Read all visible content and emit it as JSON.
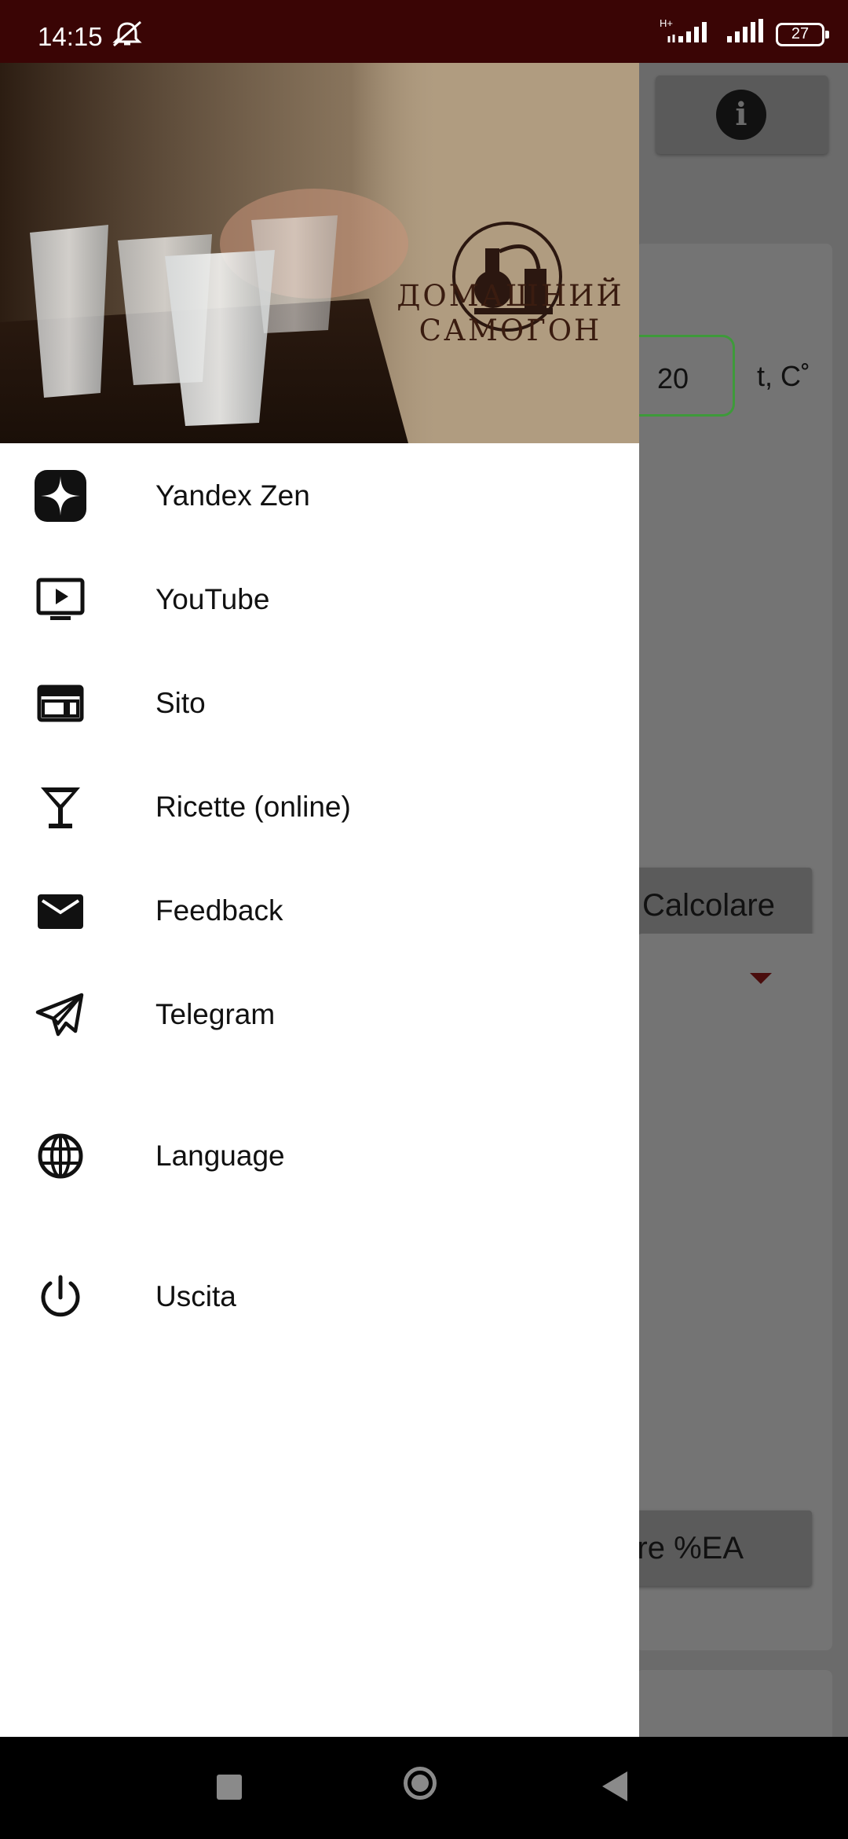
{
  "status_bar": {
    "time": "14:15",
    "network_type": "H+",
    "battery": "27"
  },
  "background": {
    "temperature_value": "20",
    "temperature_unit": "t, C˚",
    "calc_button": "Calcolare",
    "calc_ea_button": "Calcolare %EA"
  },
  "header": {
    "logo_line1": "ДОМАШНИЙ",
    "logo_line2": "САМОГОН"
  },
  "menu": {
    "items": [
      {
        "label": "Yandex Zen",
        "icon": "yandex-zen-icon"
      },
      {
        "label": "YouTube",
        "icon": "youtube-icon"
      },
      {
        "label": "Sito",
        "icon": "website-icon"
      },
      {
        "label": "Ricette (online)",
        "icon": "cocktail-glass-icon"
      },
      {
        "label": "Feedback",
        "icon": "mail-icon"
      },
      {
        "label": "Telegram",
        "icon": "telegram-icon"
      },
      {
        "label": "Language",
        "icon": "globe-icon"
      },
      {
        "label": "Uscita",
        "icon": "power-icon"
      }
    ]
  },
  "colors": {
    "status_bar": "#3a0505",
    "accent_green": "#3e9a3a",
    "dropdown_arrow": "#4a0d0d"
  }
}
